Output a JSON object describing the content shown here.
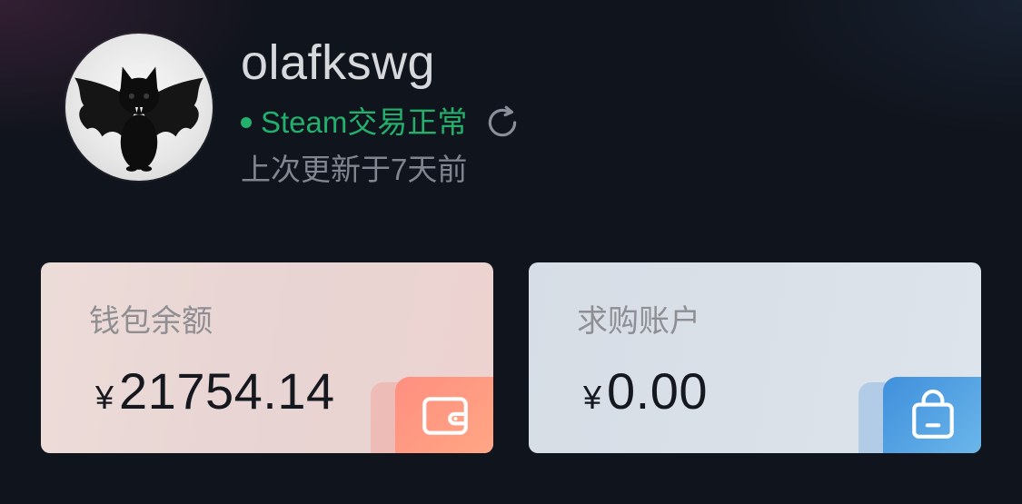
{
  "profile": {
    "username": "olafkswg",
    "status_text": "Steam交易正常",
    "status_color": "#22b06c",
    "updated_text": "上次更新于7天前",
    "avatar_icon": "black-bat-kitten-avatar",
    "refresh_icon": "refresh-icon"
  },
  "cards": {
    "wallet": {
      "label": "钱包余额",
      "currency": "¥",
      "amount": "21754.14",
      "icon": "wallet-icon"
    },
    "purchase": {
      "label": "求购账户",
      "currency": "¥",
      "amount": "0.00",
      "icon": "shopping-bag-icon"
    }
  }
}
